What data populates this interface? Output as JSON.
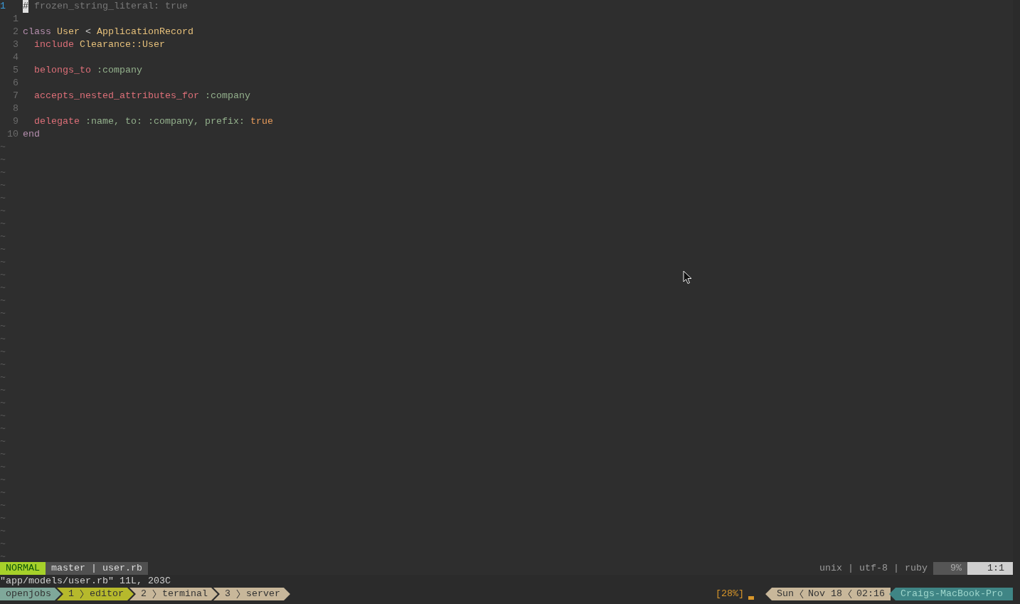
{
  "editor": {
    "lines": [
      {
        "number": "1",
        "current": true,
        "tokens": [
          {
            "text": "#",
            "kind": "cursor"
          },
          {
            "text": " frozen_string_literal: true",
            "kind": "comment"
          }
        ]
      },
      {
        "number": "1",
        "current": false
      },
      {
        "number": "2",
        "current": false,
        "tokens": [
          {
            "text": "class",
            "kind": "keyword"
          },
          {
            "text": "User",
            "kind": "constant"
          },
          {
            "text": "<",
            "kind": "plain"
          },
          {
            "text": "ApplicationRecord",
            "kind": "constant"
          }
        ]
      },
      {
        "number": "3",
        "current": false,
        "tokens": [
          {
            "text": "  include",
            "kind": "method"
          },
          {
            "text": "Clearance::User",
            "kind": "constant"
          }
        ]
      },
      {
        "number": "4",
        "current": false
      },
      {
        "number": "5",
        "current": false,
        "tokens": [
          {
            "text": "  belongs_to",
            "kind": "method"
          },
          {
            "text": ":company",
            "kind": "symbol"
          }
        ]
      },
      {
        "number": "6",
        "current": false
      },
      {
        "number": "7",
        "current": false,
        "tokens": [
          {
            "text": "  accepts_nested_attributes_for",
            "kind": "method"
          },
          {
            "text": ":company",
            "kind": "symbol"
          }
        ]
      },
      {
        "number": "8",
        "current": false
      },
      {
        "number": "9",
        "current": false,
        "tokens": [
          {
            "text": "  delegate",
            "kind": "method"
          },
          {
            "text": ":name, to: :company, prefix:",
            "kind": "symbol"
          },
          {
            "text": "true",
            "kind": "boolean"
          }
        ]
      },
      {
        "number": "10",
        "current": false,
        "tokens": [
          {
            "text": "end",
            "kind": "keyword"
          }
        ]
      }
    ],
    "empty_lines": [
      "~",
      "~",
      "~",
      "~",
      "~",
      "~",
      "~",
      "~",
      "~",
      "~",
      "~",
      "~",
      "~",
      "~",
      "~",
      "~",
      "~",
      "~",
      "~",
      "~",
      "~",
      "~",
      "~",
      "~",
      "~",
      "~",
      "~",
      "~",
      "~",
      "~",
      "~",
      "~",
      "~"
    ]
  },
  "statusline": {
    "mode": "NORMAL",
    "branch_file": "master | user.rb",
    "file_info": "unix | utf-8 | ruby",
    "percent": "9%",
    "position": "1:1"
  },
  "message": "\"app/models/user.rb\" 11L, 203C",
  "tmux": {
    "session": "openjobs",
    "windows": [
      {
        "index": "1",
        "name": "editor",
        "selected": true
      },
      {
        "index": "2",
        "name": "terminal",
        "selected": false
      },
      {
        "index": "3",
        "name": "server",
        "selected": false
      }
    ],
    "battery": "[28%]",
    "date_segments": [
      "Sun",
      "Nov 18",
      "02:16"
    ],
    "host": "Craigs-MacBook-Pro"
  }
}
